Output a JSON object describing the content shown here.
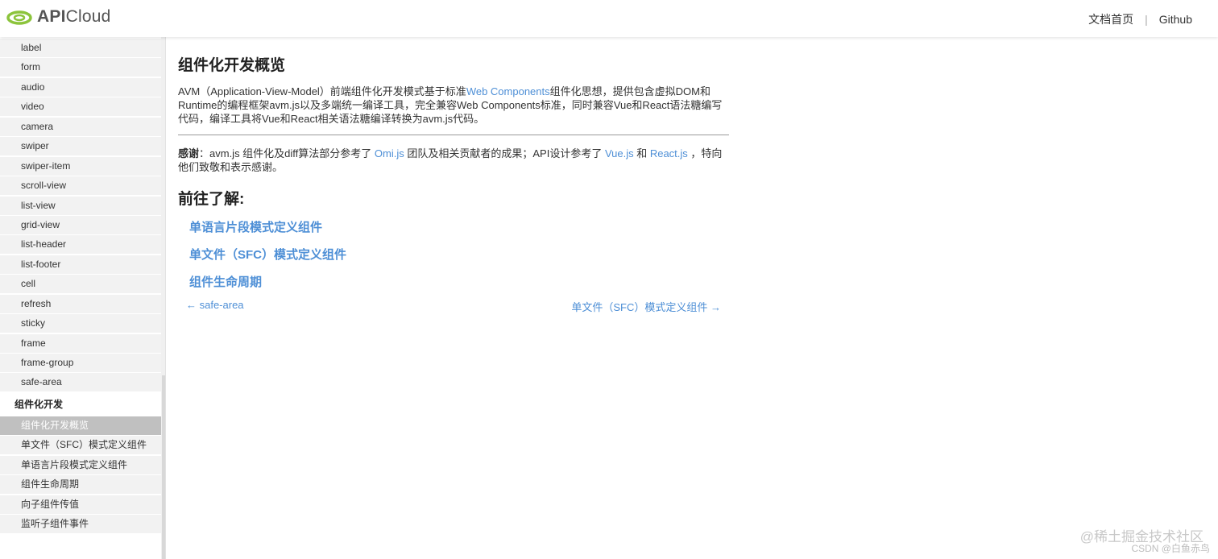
{
  "header": {
    "logo_text_bold": "API",
    "logo_text": "Cloud",
    "nav": [
      "文档首页",
      "Github"
    ],
    "separator": "|"
  },
  "sidebar": {
    "items": [
      "label",
      "form",
      "audio",
      "video",
      "camera",
      "swiper",
      "swiper-item",
      "scroll-view",
      "list-view",
      "grid-view",
      "list-header",
      "list-footer",
      "cell",
      "refresh",
      "sticky",
      "frame",
      "frame-group",
      "safe-area"
    ],
    "group": "组件化开发",
    "group_items": [
      "组件化开发概览",
      "单文件（SFC）模式定义组件",
      "单语言片段模式定义组件",
      "组件生命周期",
      "向子组件传值",
      "监听子组件事件"
    ],
    "active_index": 0
  },
  "main": {
    "title": "组件化开发概览",
    "intro_part1": "AVM（Application-View-Model）前端组件化开发模式基于标准",
    "intro_link": "Web Components",
    "intro_part2": "组件化思想，提供包含虚拟DOM和Runtime的编程框架avm.js以及多端统一编译工具，完全兼容Web Components标准，同时兼容Vue和React语法糖编写代码，编译工具将Vue和React相关语法糖编译转换为avm.js代码。",
    "thanks_label": "感谢",
    "thanks_part1": "：avm.js 组件化及diff算法部分参考了 ",
    "thanks_link1": "Omi.js",
    "thanks_part2": " 团队及相关贡献者的成果；API设计参考了 ",
    "thanks_link2": "Vue.js",
    "thanks_part3": " 和 ",
    "thanks_link3": "React.js",
    "thanks_part4": " ，特向他们致敬和表示感谢。",
    "goto_title": "前往了解:",
    "goto_links": [
      "单语言片段模式定义组件",
      "单文件（SFC）模式定义组件",
      "组件生命周期"
    ],
    "prev": "← safe-area",
    "next": "单文件（SFC）模式定义组件 →"
  },
  "watermark": {
    "line1": "@稀土掘金技术社区",
    "line2": "CSDN @白鱼赤鸟"
  },
  "colors": {
    "link": "#4e8fd6",
    "logo_green": "#8cc43c",
    "active_item_bg": "#c0c0c0"
  }
}
